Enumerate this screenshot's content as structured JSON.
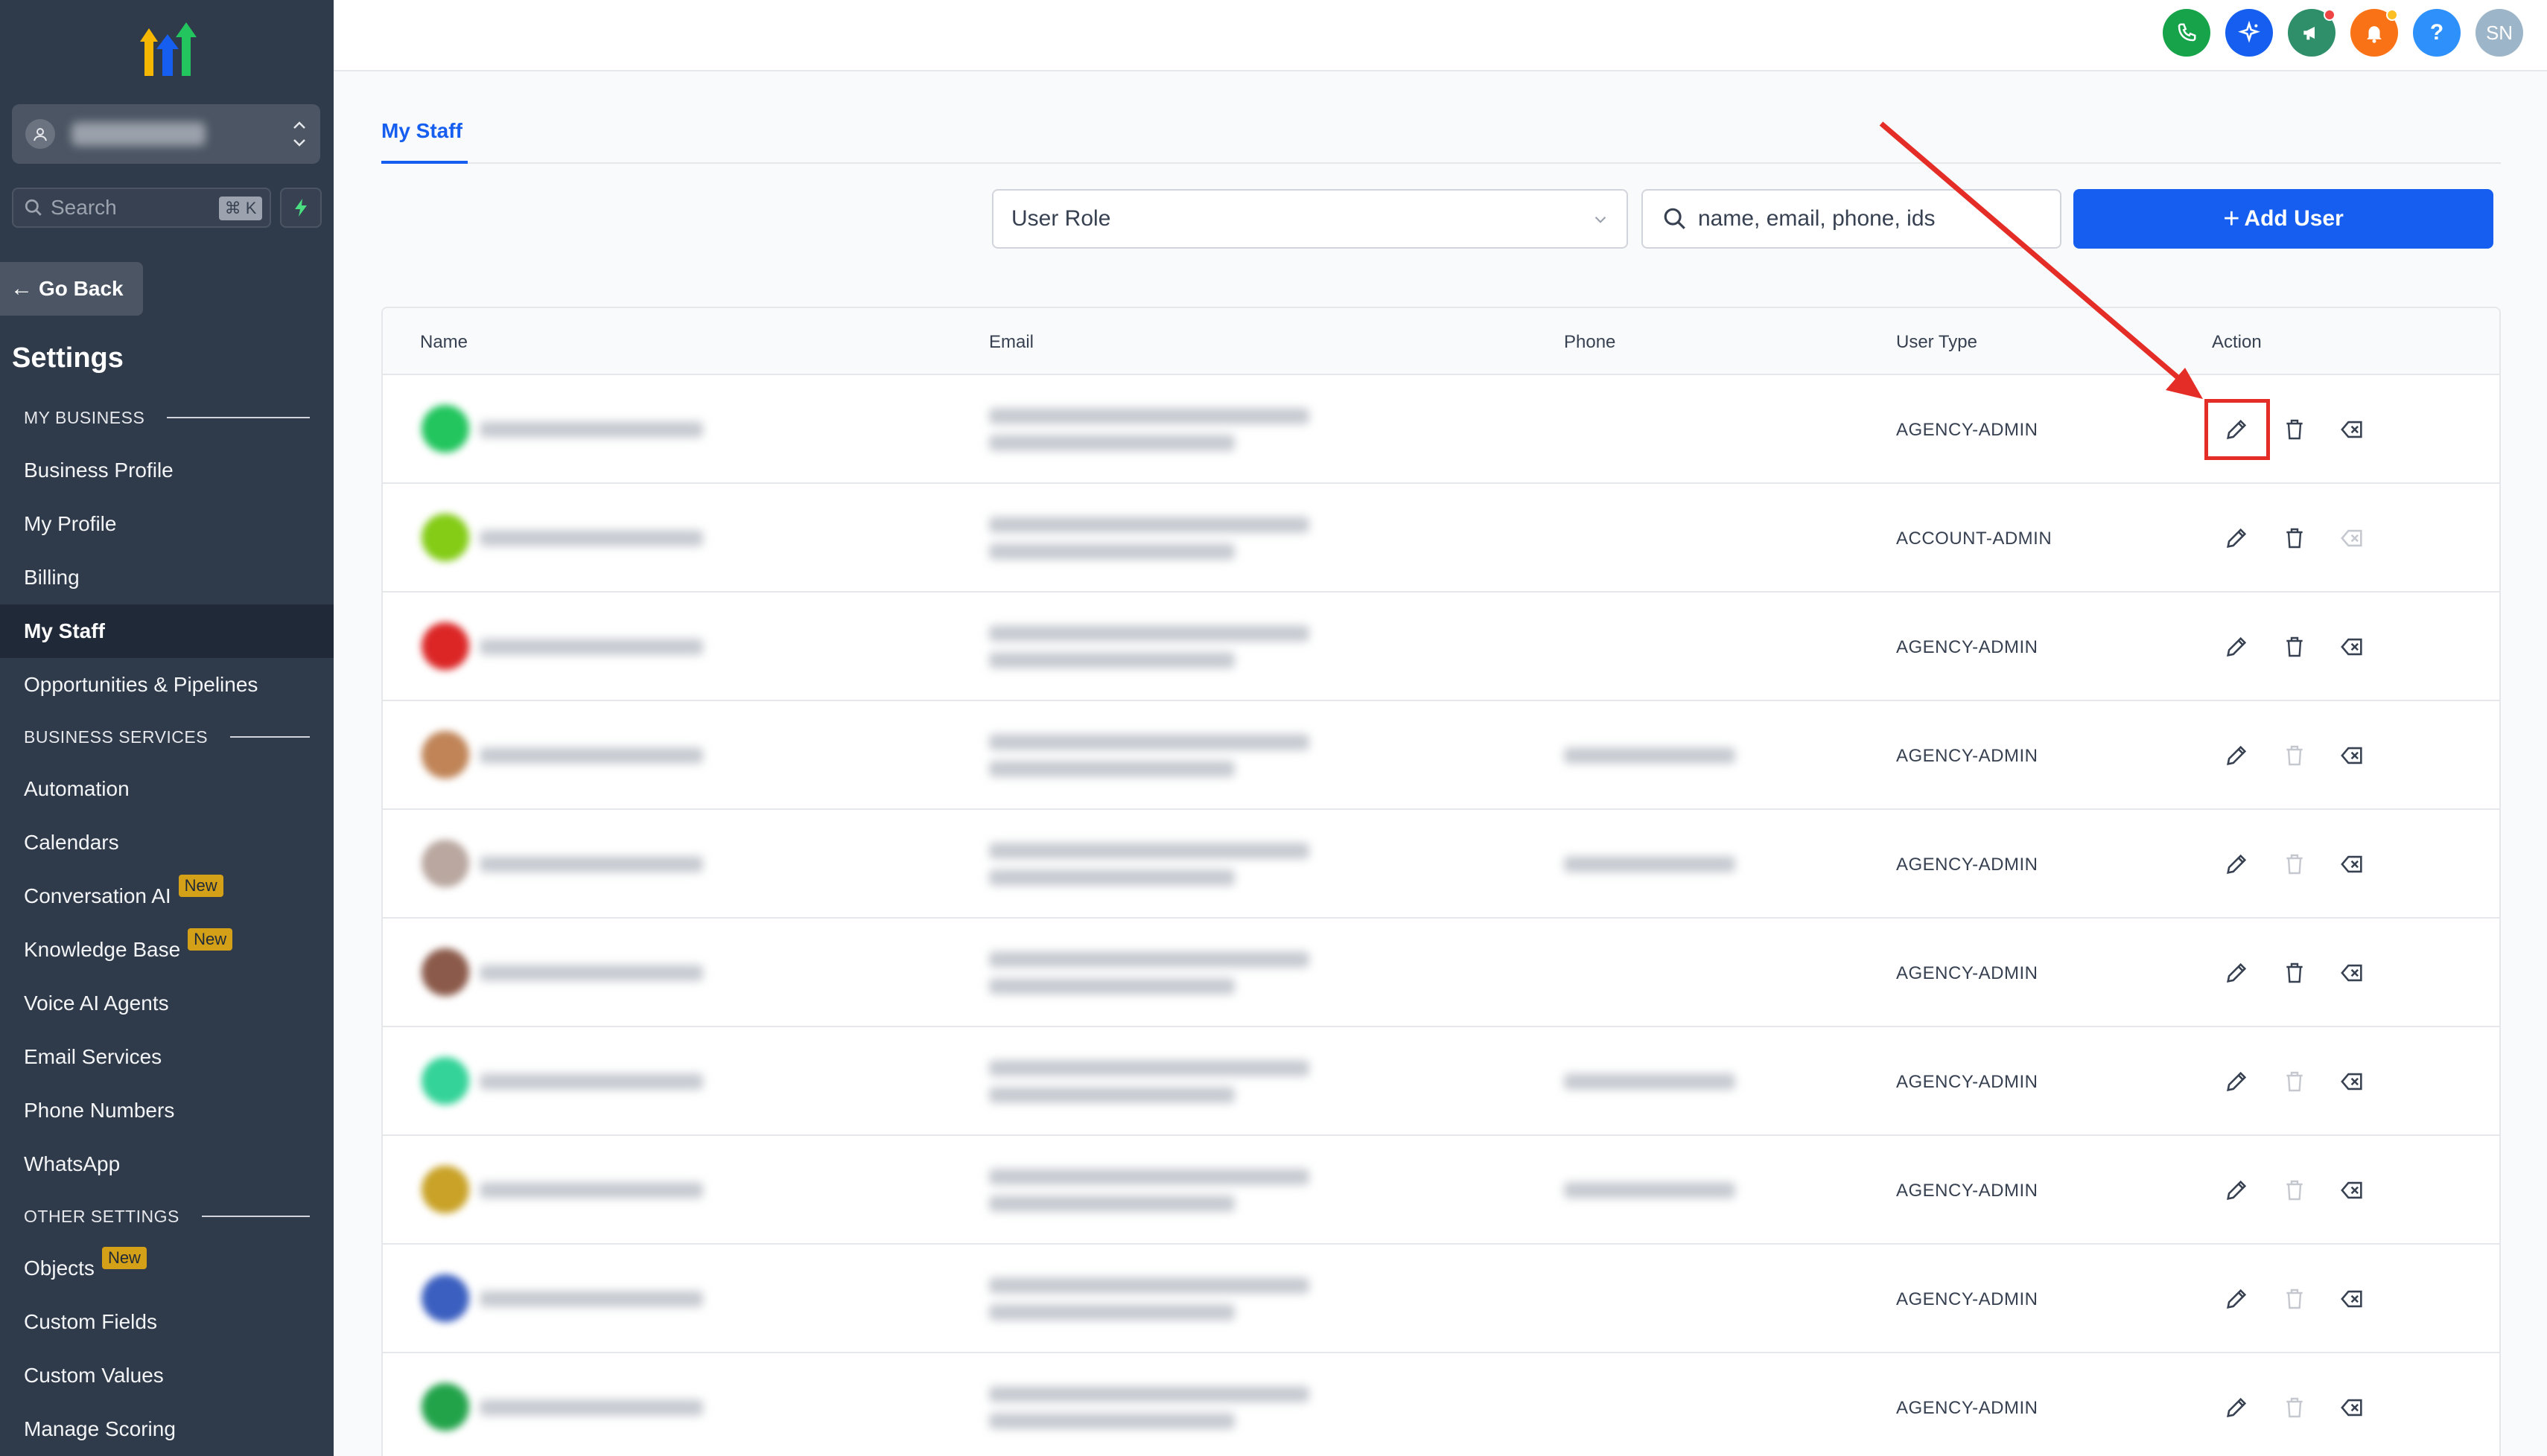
{
  "sidebar": {
    "search_label": "Search",
    "search_shortcut": "⌘ K",
    "go_back": "Go Back",
    "settings_title": "Settings",
    "sections": {
      "my_business": "MY BUSINESS",
      "business_services": "BUSINESS SERVICES",
      "other_settings": "OTHER SETTINGS"
    },
    "items": {
      "business_profile": "Business Profile",
      "my_profile": "My Profile",
      "billing": "Billing",
      "my_staff": "My Staff",
      "opportunities": "Opportunities & Pipelines",
      "automation": "Automation",
      "calendars": "Calendars",
      "conversation_ai": "Conversation AI",
      "knowledge_base": "Knowledge Base",
      "voice_ai": "Voice AI Agents",
      "email_services": "Email Services",
      "phone_numbers": "Phone Numbers",
      "whatsapp": "WhatsApp",
      "objects": "Objects",
      "custom_fields": "Custom Fields",
      "custom_values": "Custom Values",
      "manage_scoring": "Manage Scoring"
    },
    "new_badge": "New"
  },
  "topbar": {
    "help_glyph": "?",
    "user_initials": "SN",
    "colors": {
      "phone": "#16a34a",
      "ai": "#155eef",
      "announce": "#2f8f6a",
      "bell": "#f97316",
      "help": "#2e90fa",
      "user": "#9db5c8"
    }
  },
  "main": {
    "tab_label": "My Staff",
    "role_select_value": "User Role",
    "search_placeholder": "name, email, phone, ids",
    "add_user_label": "Add User",
    "table": {
      "headers": [
        "Name",
        "Email",
        "Phone",
        "User Type",
        "Action"
      ],
      "rows": [
        {
          "user_type": "AGENCY-ADMIN",
          "avatar_color": "#22c55e",
          "has_phone": false,
          "delete_enabled": true,
          "deactivate_enabled": true
        },
        {
          "user_type": "ACCOUNT-ADMIN",
          "avatar_color": "#84cc16",
          "has_phone": false,
          "delete_enabled": true,
          "deactivate_enabled": false
        },
        {
          "user_type": "AGENCY-ADMIN",
          "avatar_color": "#dc2626",
          "has_phone": false,
          "delete_enabled": true,
          "deactivate_enabled": true
        },
        {
          "user_type": "AGENCY-ADMIN",
          "avatar_color": "#c08457",
          "has_phone": true,
          "delete_enabled": false,
          "deactivate_enabled": true
        },
        {
          "user_type": "AGENCY-ADMIN",
          "avatar_color": "#b9a7a0",
          "has_phone": true,
          "delete_enabled": false,
          "deactivate_enabled": true
        },
        {
          "user_type": "AGENCY-ADMIN",
          "avatar_color": "#8b5a4a",
          "has_phone": false,
          "delete_enabled": true,
          "deactivate_enabled": true
        },
        {
          "user_type": "AGENCY-ADMIN",
          "avatar_color": "#34d399",
          "has_phone": true,
          "delete_enabled": false,
          "deactivate_enabled": true
        },
        {
          "user_type": "AGENCY-ADMIN",
          "avatar_color": "#c9a227",
          "has_phone": true,
          "delete_enabled": false,
          "deactivate_enabled": true
        },
        {
          "user_type": "AGENCY-ADMIN",
          "avatar_color": "#3b5fc0",
          "has_phone": false,
          "delete_enabled": false,
          "deactivate_enabled": true
        },
        {
          "user_type": "AGENCY-ADMIN",
          "avatar_color": "#22a34a",
          "has_phone": false,
          "delete_enabled": false,
          "deactivate_enabled": true
        }
      ]
    }
  },
  "annotation": {
    "color": "#e52d27"
  }
}
